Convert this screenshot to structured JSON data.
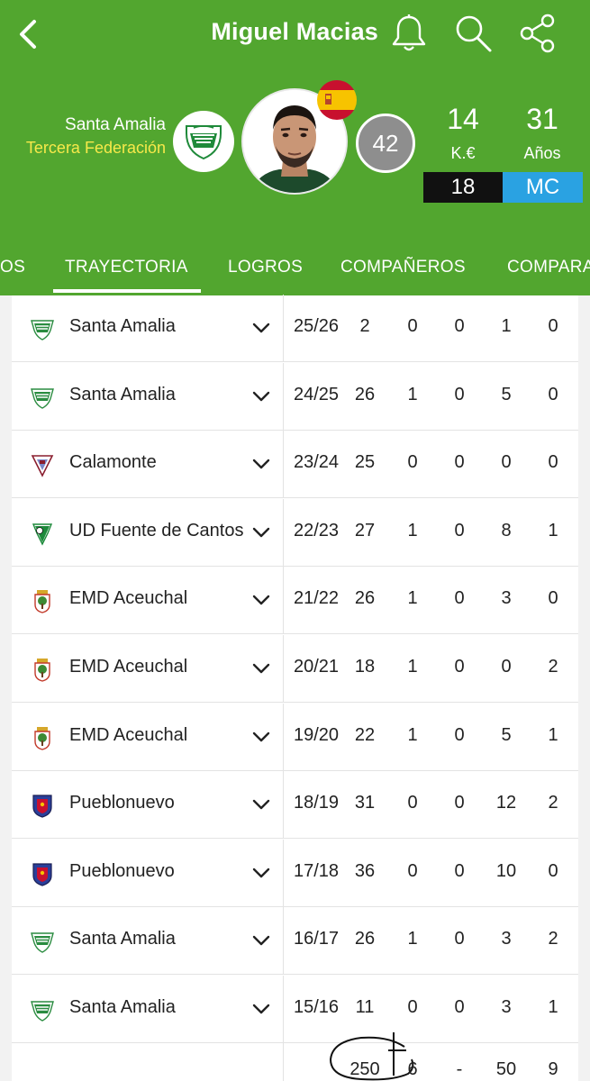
{
  "header": {
    "title": "Miguel Macias",
    "club": "Santa Amalia",
    "league": "Tercera Federación",
    "rating": "42",
    "value_num": "14",
    "value_unit": "K.€",
    "age_num": "31",
    "age_unit": "Años",
    "value_badge": "18",
    "position": "MC",
    "colors": {
      "brand_green": "#52a62f",
      "league_yellow": "#f7e94a",
      "position_blue": "#2aa2e2"
    },
    "icons": [
      "back-arrow-icon",
      "bell-icon",
      "search-icon",
      "share-icon"
    ]
  },
  "tabs": [
    {
      "label": "OS"
    },
    {
      "label": "TRAYECTORIA",
      "active": true
    },
    {
      "label": "LOGROS"
    },
    {
      "label": "COMPAÑEROS"
    },
    {
      "label": "COMPARA"
    }
  ],
  "career": [
    {
      "team": "Santa Amalia",
      "crest": "santa-amalia",
      "season": "25/26",
      "c1": "2",
      "c2": "0",
      "c3": "0",
      "c4": "1",
      "c5": "0"
    },
    {
      "team": "Santa Amalia",
      "crest": "santa-amalia",
      "season": "24/25",
      "c1": "26",
      "c2": "1",
      "c3": "0",
      "c4": "5",
      "c5": "0"
    },
    {
      "team": "Calamonte",
      "crest": "calamonte",
      "season": "23/24",
      "c1": "25",
      "c2": "0",
      "c3": "0",
      "c4": "0",
      "c5": "0"
    },
    {
      "team": "UD Fuente de Cantos",
      "crest": "fuente-cantos",
      "season": "22/23",
      "c1": "27",
      "c2": "1",
      "c3": "0",
      "c4": "8",
      "c5": "1"
    },
    {
      "team": "EMD Aceuchal",
      "crest": "aceuchal",
      "season": "21/22",
      "c1": "26",
      "c2": "1",
      "c3": "0",
      "c4": "3",
      "c5": "0"
    },
    {
      "team": "EMD Aceuchal",
      "crest": "aceuchal",
      "season": "20/21",
      "c1": "18",
      "c2": "1",
      "c3": "0",
      "c4": "0",
      "c5": "2"
    },
    {
      "team": "EMD Aceuchal",
      "crest": "aceuchal",
      "season": "19/20",
      "c1": "22",
      "c2": "1",
      "c3": "0",
      "c4": "5",
      "c5": "1"
    },
    {
      "team": "Pueblonuevo",
      "crest": "pueblonuevo",
      "season": "18/19",
      "c1": "31",
      "c2": "0",
      "c3": "0",
      "c4": "12",
      "c5": "2"
    },
    {
      "team": "Pueblonuevo",
      "crest": "pueblonuevo",
      "season": "17/18",
      "c1": "36",
      "c2": "0",
      "c3": "0",
      "c4": "10",
      "c5": "0"
    },
    {
      "team": "Santa Amalia",
      "crest": "santa-amalia",
      "season": "16/17",
      "c1": "26",
      "c2": "1",
      "c3": "0",
      "c4": "3",
      "c5": "2"
    },
    {
      "team": "Santa Amalia",
      "crest": "santa-amalia",
      "season": "15/16",
      "c1": "11",
      "c2": "0",
      "c3": "0",
      "c4": "3",
      "c5": "1"
    }
  ],
  "totals": {
    "c1": "250",
    "c2": "6",
    "c3": "-",
    "c4": "50",
    "c5": "9"
  }
}
